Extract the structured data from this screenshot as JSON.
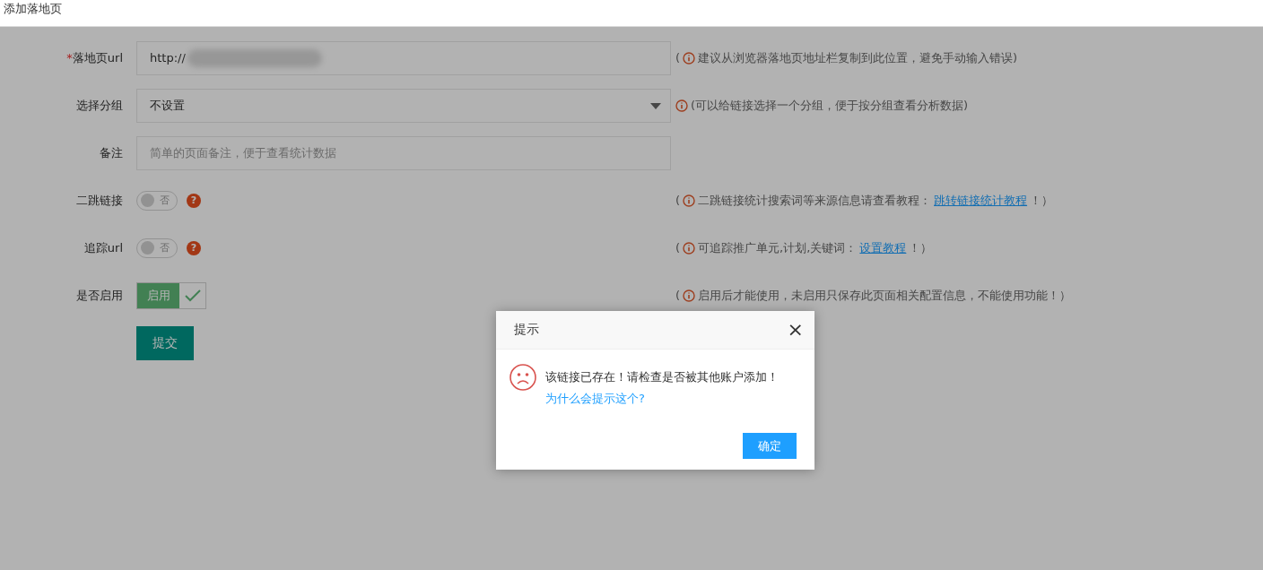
{
  "page_title": "添加落地页",
  "form": {
    "rows": [
      {
        "kind": "input",
        "label": "落地页url",
        "required_mark": "*",
        "value": "http://",
        "redacted": true,
        "hint": {
          "open": "(",
          "text": "建议从浏览器落地页地址栏复制到此位置，避免手动输入错误)"
        }
      },
      {
        "kind": "select",
        "label": "选择分组",
        "value": "不设置",
        "hint": {
          "text": "(可以给链接选择一个分组，便于按分组查看分析数据)"
        }
      },
      {
        "kind": "input",
        "label": "备注",
        "placeholder": "简单的页面备注，便于查看统计数据"
      },
      {
        "kind": "toggle",
        "label": "二跳链接",
        "on": false,
        "state_text": "否",
        "help": "?",
        "hint": {
          "open": "(",
          "text": "二跳链接统计搜索词等来源信息请查看教程：",
          "link": "跳转链接统计教程",
          "close": "！）"
        }
      },
      {
        "kind": "toggle",
        "label": "追踪url",
        "on": false,
        "state_text": "否",
        "help": "?",
        "hint": {
          "open": "(",
          "text": "可追踪推广单元,计划,关键词：",
          "link": "设置教程",
          "close": "！）"
        }
      },
      {
        "kind": "check-switch",
        "label": "是否启用",
        "on": true,
        "state_text": "启用",
        "hint": {
          "open": "(",
          "text": "启用后才能使用，未启用只保存此页面相关配置信息，不能使用功能！）"
        }
      }
    ],
    "submit": "提交"
  },
  "dialog": {
    "title": "提示",
    "close": "×",
    "message": "该链接已存在！请检查是否被其他账户添加！",
    "link": "为什么会提示这个?",
    "button": "确定"
  }
}
